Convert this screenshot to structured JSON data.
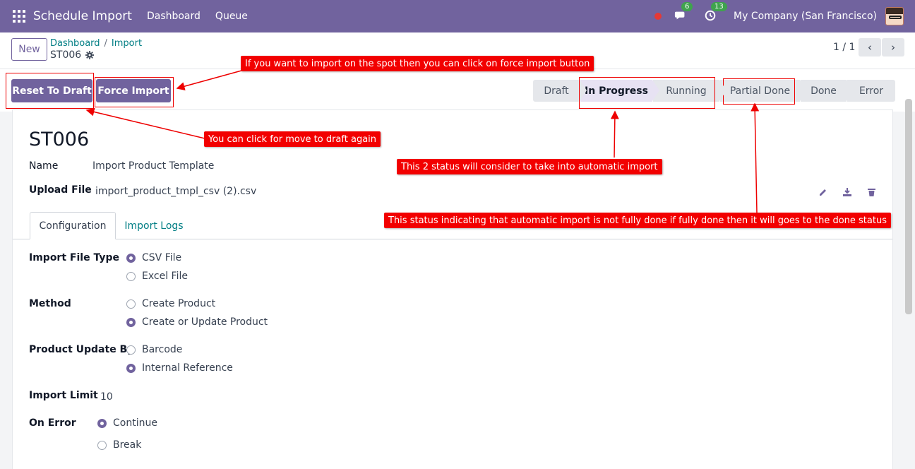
{
  "navbar": {
    "app_title": "Schedule Import",
    "links": [
      "Dashboard",
      "Queue"
    ],
    "chat_badge": "6",
    "activity_badge": "13",
    "company": "My Company (San Francisco)"
  },
  "control": {
    "new_label": "New",
    "breadcrumb": [
      "Dashboard",
      "Import"
    ],
    "record": "ST006",
    "pager": "1 / 1"
  },
  "actions": {
    "reset": "Reset To Draft",
    "force": "Force Import"
  },
  "stages": [
    {
      "label": "Draft",
      "active": false
    },
    {
      "label": "In Progress",
      "active": true
    },
    {
      "label": "Running",
      "active": false
    },
    {
      "label": "Partial Done",
      "active": false
    },
    {
      "label": "Done",
      "active": false
    },
    {
      "label": "Error",
      "active": false
    }
  ],
  "form": {
    "title": "ST006",
    "name_label": "Name",
    "name_value": "Import Product Template",
    "upload_label": "Upload File",
    "upload_value": "import_product_tmpl_csv (2).csv",
    "tabs": [
      "Configuration",
      "Import Logs"
    ],
    "file_type_label": "Import File Type",
    "file_type_options": [
      {
        "label": "CSV File",
        "checked": true
      },
      {
        "label": "Excel File",
        "checked": false
      }
    ],
    "method_label": "Method",
    "method_options": [
      {
        "label": "Create Product",
        "checked": false
      },
      {
        "label": "Create or Update Product",
        "checked": true
      }
    ],
    "update_by_label": "Product Update By",
    "update_by_options": [
      {
        "label": "Barcode",
        "checked": false
      },
      {
        "label": "Internal Reference",
        "checked": true
      }
    ],
    "limit_label": "Import Limit",
    "limit_value": "10",
    "on_error_label": "On Error",
    "on_error_options": [
      {
        "label": "Continue",
        "checked": true
      },
      {
        "label": "Break",
        "checked": false
      }
    ]
  },
  "annotations": {
    "force_note": "If you want to import on the spot then you can click on force import button",
    "draft_note": "You can click for move to draft again",
    "status_note": "This 2 status will consider to take into automatic import",
    "partial_note": "This status indicating that automatic import is not fully done if fully done then it will goes to the done status"
  },
  "colors": {
    "brand": "#71639e",
    "link": "#017e84",
    "annotation": "#f20000"
  }
}
